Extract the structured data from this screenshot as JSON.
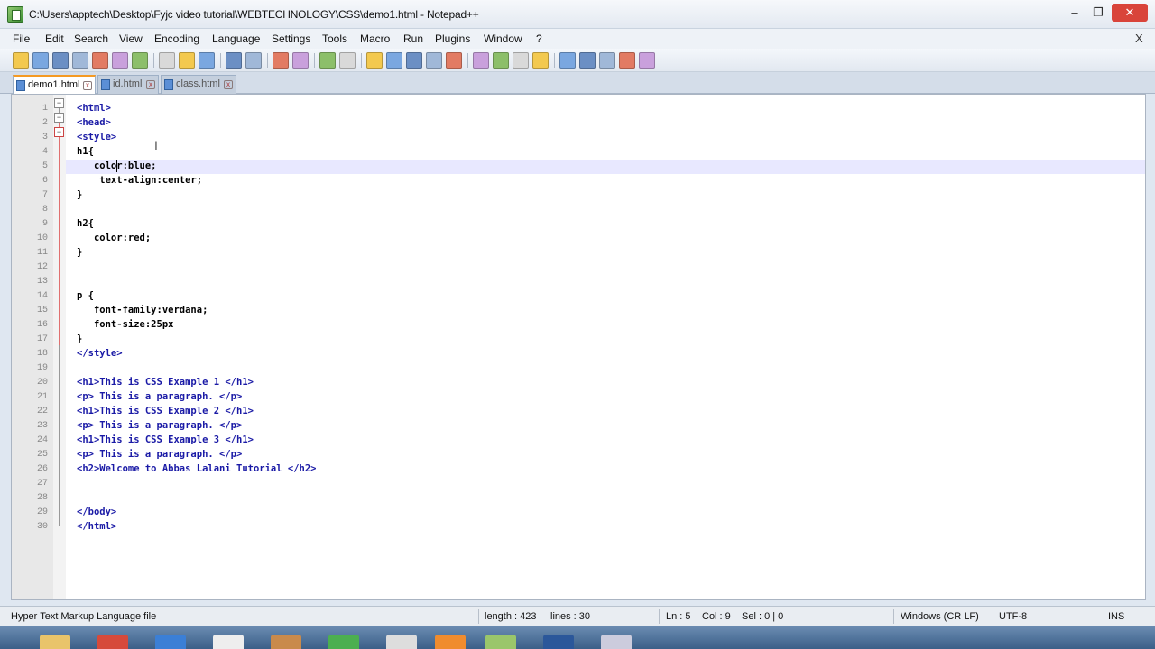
{
  "window": {
    "title": "C:\\Users\\apptech\\Desktop\\Fyjc video tutorial\\WEBTECHNOLOGY\\CSS\\demo1.html - Notepad++",
    "min": "–",
    "max": "❐",
    "close": "✕"
  },
  "menu": [
    "File",
    "Edit",
    "Search",
    "View",
    "Encoding",
    "Language",
    "Settings",
    "Tools",
    "Macro",
    "Run",
    "Plugins",
    "Window",
    "?"
  ],
  "doc_close": "X",
  "tabs": [
    {
      "label": "demo1.html",
      "active": true
    },
    {
      "label": "id.html",
      "active": false
    },
    {
      "label": "class.html",
      "active": false
    }
  ],
  "lines": [
    {
      "n": "1",
      "text": "<html>",
      "tag": true
    },
    {
      "n": "2",
      "text": "<head>",
      "tag": true
    },
    {
      "n": "3",
      "text": "<style>",
      "tag": true
    },
    {
      "n": "4",
      "text": "h1{",
      "tag": false
    },
    {
      "n": "5",
      "text": "   color:blue;",
      "tag": false,
      "current": true
    },
    {
      "n": "6",
      "text": "    text-align:center;",
      "tag": false
    },
    {
      "n": "7",
      "text": "}",
      "tag": false
    },
    {
      "n": "8",
      "text": "",
      "tag": false
    },
    {
      "n": "9",
      "text": "h2{",
      "tag": false
    },
    {
      "n": "10",
      "text": "   color:red;",
      "tag": false
    },
    {
      "n": "11",
      "text": "}",
      "tag": false
    },
    {
      "n": "12",
      "text": "",
      "tag": false
    },
    {
      "n": "13",
      "text": "",
      "tag": false
    },
    {
      "n": "14",
      "text": "p {",
      "tag": false
    },
    {
      "n": "15",
      "text": "   font-family:verdana;",
      "tag": false
    },
    {
      "n": "16",
      "text": "   font-size:25px",
      "tag": false
    },
    {
      "n": "17",
      "text": "}",
      "tag": false
    },
    {
      "n": "18",
      "text": "</style>",
      "tag": true
    },
    {
      "n": "19",
      "text": "",
      "tag": false
    },
    {
      "n": "20",
      "text": "<h1>This is CSS Example 1 </h1>",
      "tag": true
    },
    {
      "n": "21",
      "text": "<p> This is a paragraph. </p>",
      "tag": true
    },
    {
      "n": "22",
      "text": "<h1>This is CSS Example 2 </h1>",
      "tag": true
    },
    {
      "n": "23",
      "text": "<p> This is a paragraph. </p>",
      "tag": true
    },
    {
      "n": "24",
      "text": "<h1>This is CSS Example 3 </h1>",
      "tag": true
    },
    {
      "n": "25",
      "text": "<p> This is a paragraph. </p>",
      "tag": true
    },
    {
      "n": "26",
      "text": "<h2>Welcome to Abbas Lalani Tutorial </h2>",
      "tag": true
    },
    {
      "n": "27",
      "text": "",
      "tag": false
    },
    {
      "n": "28",
      "text": "",
      "tag": false
    },
    {
      "n": "29",
      "text": "</body>",
      "tag": true
    },
    {
      "n": "30",
      "text": "</html>",
      "tag": true
    }
  ],
  "status": {
    "filetype": "Hyper Text Markup Language file",
    "length": "length : 423",
    "lines": "lines : 30",
    "ln": "Ln : 5",
    "col": "Col : 9",
    "sel": "Sel : 0 | 0",
    "eol": "Windows (CR LF)",
    "encoding": "UTF-8",
    "mode": "INS"
  },
  "colors": {
    "accent": "#f59a23",
    "tag": "#1a1aa6",
    "current_line": "#e8e8ff"
  },
  "toolbar_icons": [
    "new-file-icon",
    "open-file-icon",
    "save-icon",
    "save-all-icon",
    "close-icon",
    "close-all-icon",
    "print-icon",
    "cut-icon",
    "copy-icon",
    "paste-icon",
    "undo-icon",
    "redo-icon",
    "find-icon",
    "replace-icon",
    "zoom-in-icon",
    "zoom-out-icon",
    "sync-v-icon",
    "sync-h-icon",
    "wrap-icon",
    "all-chars-icon",
    "indent-guide-icon",
    "doc-map-icon",
    "function-list-icon",
    "folder-workspace-icon",
    "monitor-icon",
    "record-macro-icon",
    "stop-macro-icon",
    "play-macro-icon",
    "run-macro-multiple-icon",
    "save-macro-icon"
  ]
}
